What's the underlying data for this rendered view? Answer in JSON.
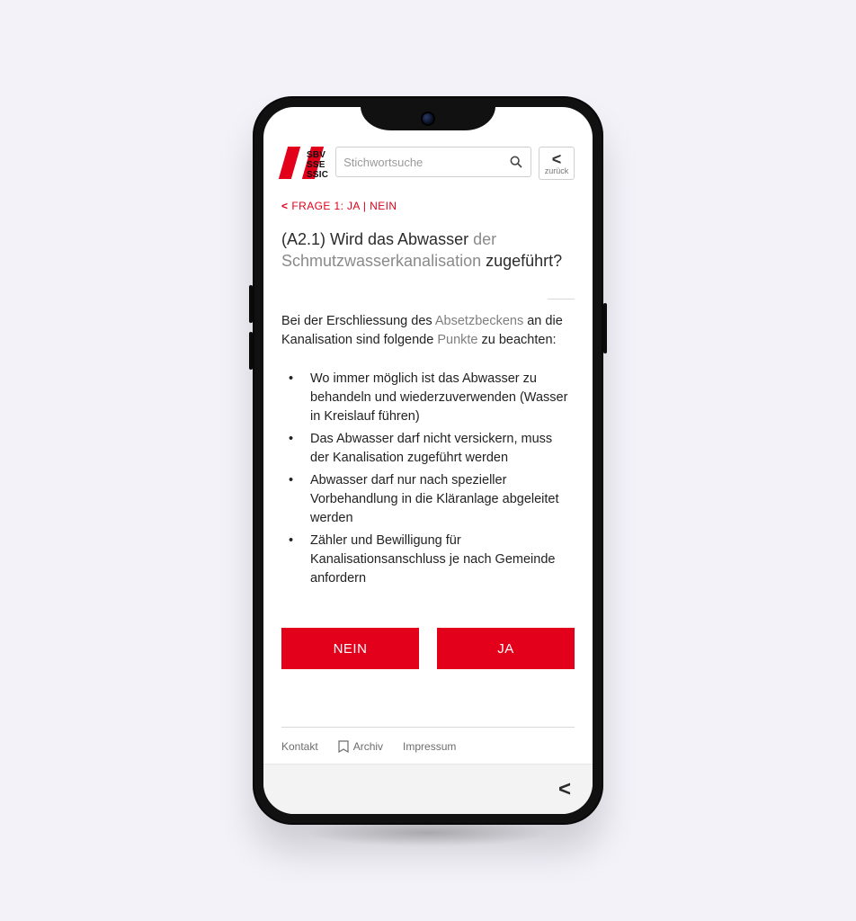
{
  "logo": {
    "line1": "SBV",
    "line2": "SSE",
    "line3": "SSIC"
  },
  "search": {
    "placeholder": "Stichwortsuche"
  },
  "backButton": {
    "glyph": "<",
    "label": "zurück"
  },
  "breadcrumb": {
    "glyph": "<",
    "text": "FRAGE 1: JA | NEIN"
  },
  "question": {
    "pre": "(A2.1) Wird das Abwasser ",
    "mid_light": "der Schmutzwasserkanalisation",
    "post": " zugeführt?"
  },
  "intro": {
    "a": "Bei der Erschliessung des ",
    "b_muted": "Absetzbeckens",
    "c": " an die Kanalisation sind folgende ",
    "d_muted": "Punkte",
    "e": " zu beachten:"
  },
  "points": [
    "Wo immer möglich ist das Abwasser zu behandeln und wiederzuverwenden (Wasser in Kreislauf führen)",
    "Das Abwasser darf nicht versickern, muss der Kanalisation zugeführt werden",
    "Abwasser darf nur nach spezieller Vorbehandlung in die Kläranlage abgeleitet werden",
    "Zähler und Bewilligung für Kanalisationsanschluss je nach Gemeinde anfordern"
  ],
  "actions": {
    "no": "NEIN",
    "yes": "JA"
  },
  "footer": {
    "contact": "Kontakt",
    "archive": "Archiv",
    "imprint": "Impressum"
  },
  "bottomBar": {
    "glyph": "<"
  }
}
